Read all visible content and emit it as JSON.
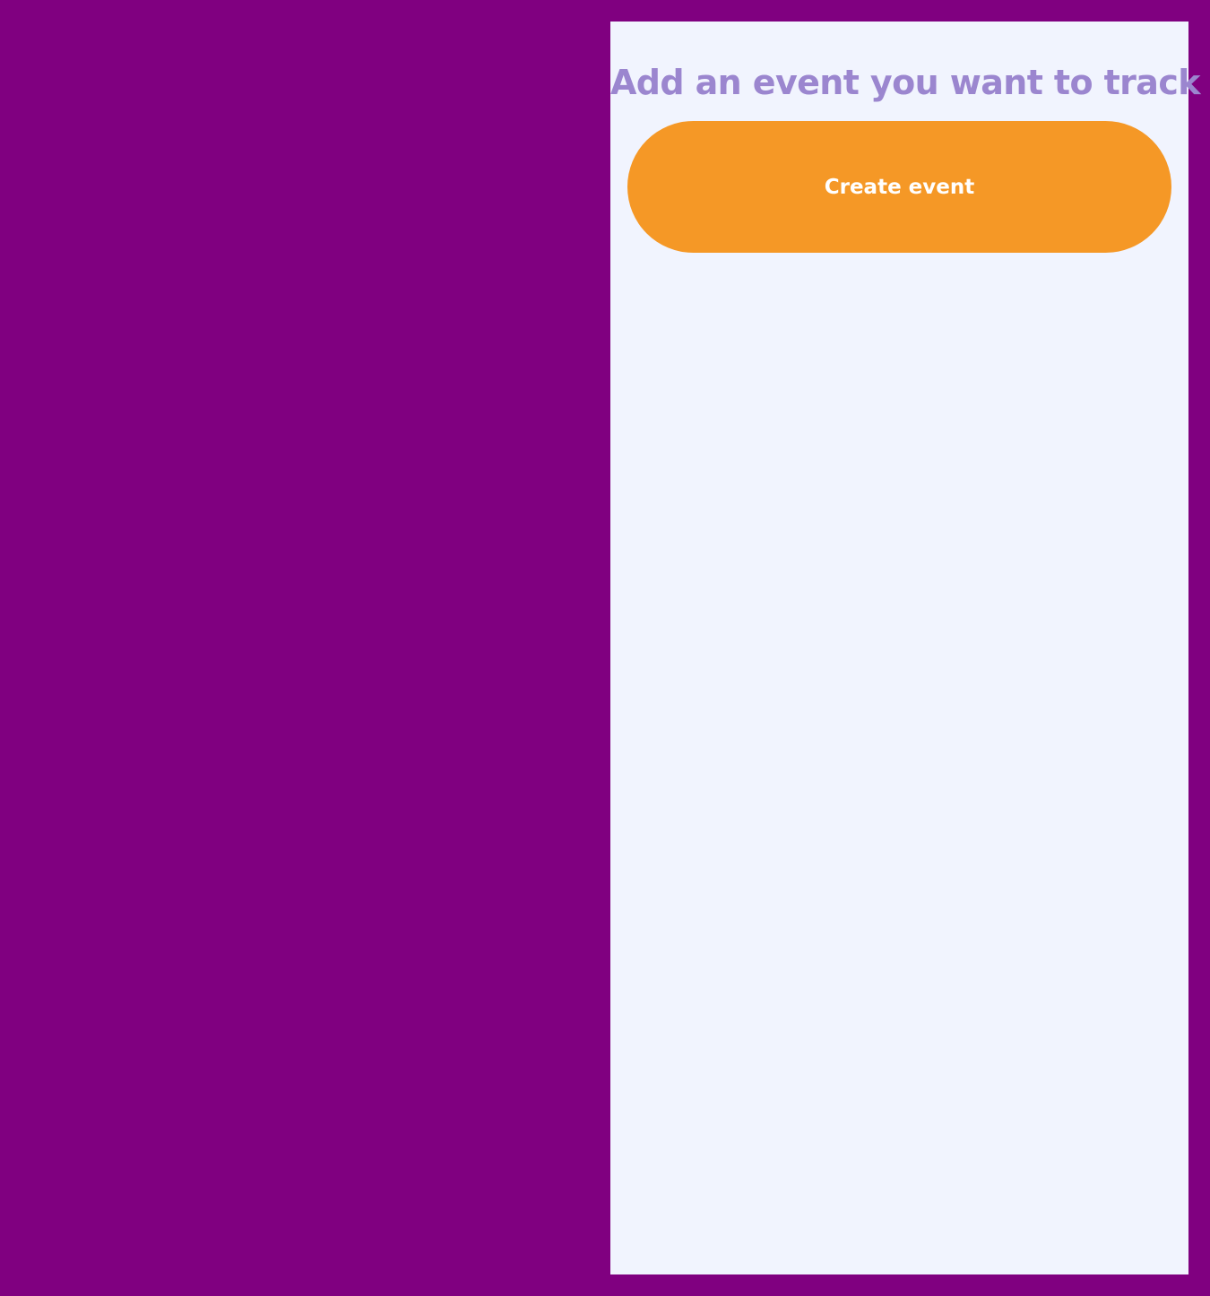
{
  "colors": {
    "background": "#800080",
    "panel": "#f1f4fe",
    "title": "#9b86cf",
    "button": "#f59826",
    "button_text": "#ffffff"
  },
  "panel": {
    "title": "Add an event you want to track",
    "create_button_label": "Create event"
  }
}
